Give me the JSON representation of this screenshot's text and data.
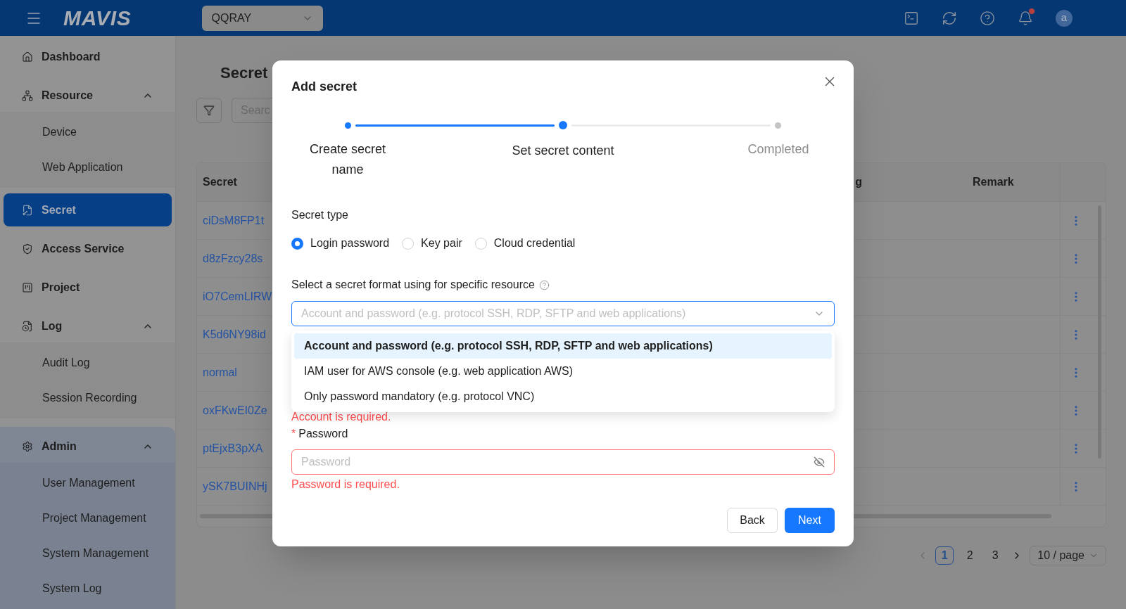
{
  "header": {
    "logo": "MAVIS",
    "project_select": {
      "value": "QQRAY"
    },
    "notifications": {
      "unread": true
    },
    "avatar": "a"
  },
  "sidebar": {
    "items": [
      {
        "label": "Dashboard",
        "selected": false
      },
      {
        "label": "Resource",
        "selected": false,
        "expanded": true,
        "children": [
          {
            "label": "Device",
            "selected": false
          },
          {
            "label": "Web Application",
            "selected": false
          }
        ]
      },
      {
        "label": "Secret",
        "selected": true
      },
      {
        "label": "Access Service",
        "selected": false
      },
      {
        "label": "Project",
        "selected": false
      },
      {
        "label": "Log",
        "selected": false,
        "expanded": true,
        "children": [
          {
            "label": "Audit Log",
            "selected": false
          },
          {
            "label": "Session Recording",
            "selected": false
          }
        ]
      },
      {
        "label": "Admin",
        "selected": false,
        "expanded": true,
        "children": [
          {
            "label": "User Management",
            "selected": false
          },
          {
            "label": "Project Management",
            "selected": false
          },
          {
            "label": "System Management",
            "selected": false
          },
          {
            "label": "System Log",
            "selected": false
          }
        ]
      }
    ]
  },
  "page": {
    "title": "Secret",
    "search": {
      "placeholder": "Searc"
    },
    "table": {
      "columns": [
        "Secret",
        "g",
        "Remark"
      ],
      "rows": [
        {
          "secret": "ciDsM8FP1t"
        },
        {
          "secret": "d8zFzcy28s"
        },
        {
          "secret": "iO7CemLIRW"
        },
        {
          "secret": "K5d6NY98id"
        },
        {
          "secret": "normal"
        },
        {
          "secret": "oxFKwEI0Ze"
        },
        {
          "secret": "ptEjxB3pXA"
        },
        {
          "secret": "ySK7BUINHj"
        }
      ]
    },
    "pagination": {
      "pages": [
        {
          "label": "1",
          "selected": true
        },
        {
          "label": "2",
          "selected": false
        },
        {
          "label": "3",
          "selected": false
        }
      ],
      "page_size": "10 / page"
    }
  },
  "modal": {
    "title": "Add secret",
    "steps": [
      {
        "label": "Create secret name",
        "done": true,
        "selected": false
      },
      {
        "label": "Set secret content",
        "done": false,
        "selected": true
      },
      {
        "label": "Completed",
        "done": false,
        "selected": false
      }
    ],
    "secret_type": {
      "label": "Secret type",
      "options": [
        {
          "label": "Login password",
          "selected": true
        },
        {
          "label": "Key pair",
          "selected": false
        },
        {
          "label": "Cloud credential",
          "selected": false
        }
      ]
    },
    "format": {
      "label": "Select a secret format using for specific resource",
      "placeholder": "Account and password (e.g. protocol SSH, RDP, SFTP and web applications)",
      "expanded": true,
      "options": [
        {
          "label": "Account and password (e.g. protocol SSH, RDP, SFTP and web applications)",
          "selected": true
        },
        {
          "label": "IAM user for AWS console (e.g. web application AWS)",
          "selected": false
        },
        {
          "label": "Only password mandatory (e.g. protocol VNC)",
          "selected": false
        }
      ]
    },
    "account_error": "Account is required.",
    "password": {
      "required_mark": "*",
      "label": "Password",
      "placeholder": "Password",
      "error": "Password is required."
    },
    "buttons": {
      "back": "Back",
      "next": "Next"
    }
  }
}
